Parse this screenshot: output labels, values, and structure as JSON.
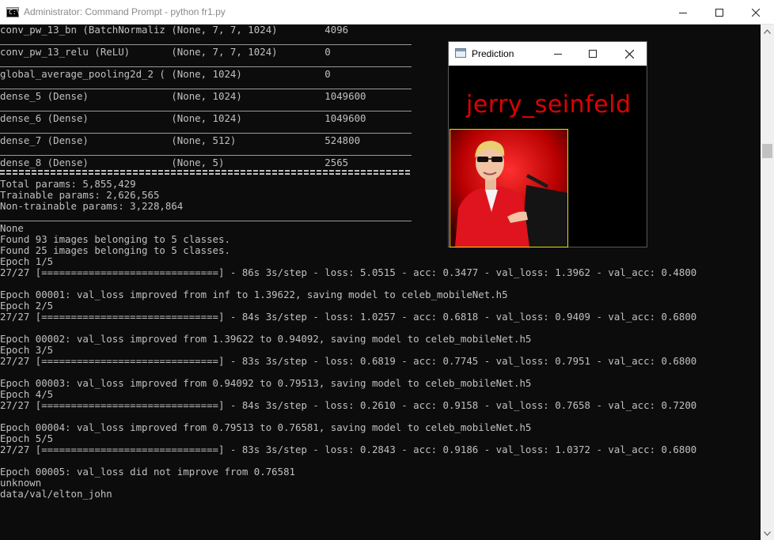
{
  "window": {
    "title": "Administrator: Command Prompt - python  fr1.py",
    "icon_glyph": "C:\\"
  },
  "console": {
    "lines": [
      "conv_pw_13_bn (BatchNormaliz (None, 7, 7, 1024)        4096",
      "conv_pw_13_relu (ReLU)       (None, 7, 7, 1024)        0",
      "global_average_pooling2d_2 ( (None, 1024)              0",
      "dense_5 (Dense)              (None, 1024)              1049600",
      "dense_6 (Dense)              (None, 1024)              1049600",
      "dense_7 (Dense)              (None, 512)               524800",
      "dense_8 (Dense)              (None, 5)                 2565",
      "Total params: 5,855,429",
      "Trainable params: 2,626,565",
      "Non-trainable params: 3,228,864",
      "None",
      "Found 93 images belonging to 5 classes.",
      "Found 25 images belonging to 5 classes.",
      "Epoch 1/5",
      "27/27 [==============================] - 86s 3s/step - loss: 5.0515 - acc: 0.3477 - val_loss: 1.3962 - val_acc: 0.4800",
      "Epoch 00001: val_loss improved from inf to 1.39622, saving model to celeb_mobileNet.h5",
      "Epoch 2/5",
      "27/27 [==============================] - 84s 3s/step - loss: 1.0257 - acc: 0.6818 - val_loss: 0.9409 - val_acc: 0.6800",
      "Epoch 00002: val_loss improved from 1.39622 to 0.94092, saving model to celeb_mobileNet.h5",
      "Epoch 3/5",
      "27/27 [==============================] - 83s 3s/step - loss: 0.6819 - acc: 0.7745 - val_loss: 0.7951 - val_acc: 0.6800",
      "Epoch 00003: val_loss improved from 0.94092 to 0.79513, saving model to celeb_mobileNet.h5",
      "Epoch 4/5",
      "27/27 [==============================] - 84s 3s/step - loss: 0.2610 - acc: 0.9158 - val_loss: 0.7658 - val_acc: 0.7200",
      "Epoch 00004: val_loss improved from 0.79513 to 0.76581, saving model to celeb_mobileNet.h5",
      "Epoch 5/5",
      "27/27 [==============================] - 83s 3s/step - loss: 0.2843 - acc: 0.9186 - val_loss: 1.0372 - val_acc: 0.6800",
      "Epoch 00005: val_loss did not improve from 0.76581",
      "unknown",
      "data/val/elton_john"
    ]
  },
  "prediction_window": {
    "title": "Prediction",
    "predicted_label": "jerry_seinfeld",
    "label_color": "#e00000"
  },
  "colors": {
    "console_bg": "#0c0c0c",
    "console_text": "#c0c0c0",
    "image_border": "#e8e000"
  },
  "icons": {
    "titlebar": "command-prompt-icon",
    "minimize": "minimize-icon",
    "maximize": "maximize-icon",
    "close": "close-icon"
  }
}
